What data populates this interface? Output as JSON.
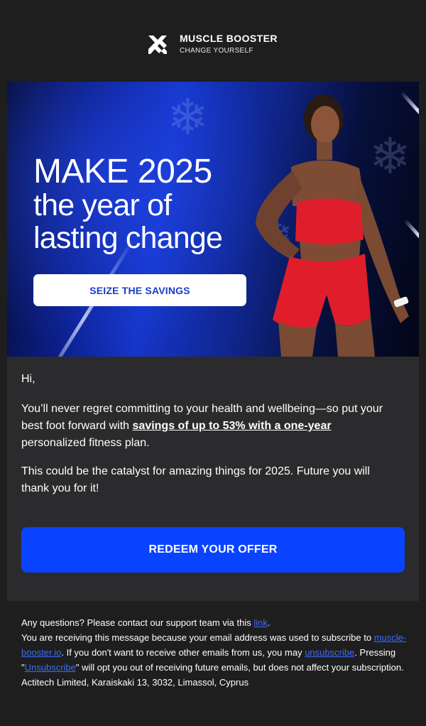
{
  "header": {
    "brand_name": "MUSCLE BOOSTER",
    "brand_tagline": "CHANGE YOURSELF",
    "logo_icon": "muscle-booster-logo-icon"
  },
  "hero": {
    "headline_line1": "MAKE 2025",
    "headline_line2": "the year of",
    "headline_line3": "lasting change",
    "cta_label": "SEIZE THE SAVINGS"
  },
  "body": {
    "greeting": "Hi,",
    "para1_before": "You’ll never regret committing to your health and wellbeing—so put your best foot forward with ",
    "para1_highlight": "savings of up to 53% with a one-year",
    "para1_after": " personalized fitness plan.",
    "para2": "This could be the catalyst for amazing things for 2025. Future you will thank you for it!",
    "cta_label": "REDEEM YOUR OFFER"
  },
  "footer": {
    "support_before": "Any questions? Please contact our support team via this ",
    "support_link": "link",
    "support_after": ".",
    "sub_before": "You are receiving this message because your email address was used to subscribe to ",
    "sub_link": "muscle-booster.io",
    "sub_mid": ". If you don't want to receive other emails from us, you may ",
    "unsubscribe_link": "unsubscribe",
    "sub_mid2": ". Pressing \"",
    "unsubscribe_link2": "Unsubscribe",
    "sub_after": "\" will opt you out of receiving future emails, but does not affect your subscription.",
    "address": "Actitech Limited, Karaiskaki 13, 3032, Limassol, Cyprus"
  },
  "colors": {
    "background": "#1e1e1e",
    "card": "#2b2b2d",
    "accent_blue": "#0a43ff",
    "link": "#3a6cff",
    "outfit_red": "#e01e2b"
  }
}
